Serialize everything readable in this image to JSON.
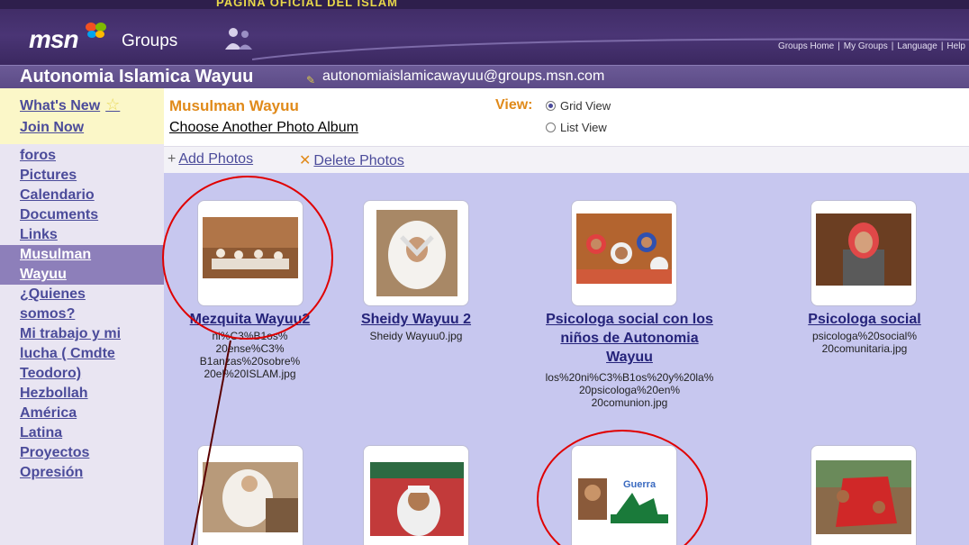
{
  "header": {
    "banner": "PAGINA OFICIAL DEL ISLAM",
    "logo": "msn",
    "product": "Groups",
    "links": [
      "Groups Home",
      "My Groups",
      "Language",
      "Help"
    ]
  },
  "group": {
    "name": "Autonomia Islamica Wayuu",
    "email": "autonomiaislamicawayuu@groups.msn.com"
  },
  "sidebar": {
    "top": [
      {
        "label": "What's New"
      },
      {
        "label": "Join Now"
      }
    ],
    "nav": [
      {
        "label": "foros"
      },
      {
        "label": "Pictures"
      },
      {
        "label": "Calendario"
      },
      {
        "label": "Documents"
      },
      {
        "label": "Links"
      },
      {
        "label": "Musulman"
      },
      {
        "label": "Wayuu"
      },
      {
        "label": "¿Quienes"
      },
      {
        "label": "somos?"
      },
      {
        "label": "Mi trabajo y mi"
      },
      {
        "label": "lucha ( Cmdte"
      },
      {
        "label": "Teodoro)"
      },
      {
        "label": "Hezbollah"
      },
      {
        "label": "América"
      },
      {
        "label": "Latina"
      },
      {
        "label": "Proyectos"
      },
      {
        "label": "Opresión"
      }
    ]
  },
  "album": {
    "title": "Musulman Wayuu",
    "choose": "Choose Another Photo Album",
    "view_label": "View:",
    "view_options": [
      "Grid View",
      "List View"
    ],
    "selected_view": "Grid View"
  },
  "toolbar": {
    "add": "Add Photos",
    "delete": "Delete Photos"
  },
  "photos": [
    {
      "title": [
        "Mezquita Wayuu2"
      ],
      "file": [
        "ni%C3%B1os%",
        "20ense%C3%",
        "B1anzas%20sobre%",
        "20el%20ISLAM.jpg"
      ]
    },
    {
      "title": [
        "Sheidy Wayuu 2"
      ],
      "file": [
        "Sheidy Wayuu0.jpg"
      ]
    },
    {
      "title": [
        "Psicologa social con los",
        "niños de Autonomia",
        "Wayuu"
      ],
      "file": [
        "los%20ni%C3%B1os%20y%20la%",
        "20psicologa%20en%",
        "20comunion.jpg"
      ]
    },
    {
      "title": [
        "Psicologa social"
      ],
      "file": [
        "psicologa%20social%",
        "20comunitaria.jpg"
      ]
    },
    {
      "title": [],
      "file": []
    },
    {
      "title": [],
      "file": []
    },
    {
      "title": [],
      "file": [],
      "thumb_text": "Guerra"
    },
    {
      "title": [],
      "file": []
    }
  ],
  "colors": {
    "header_bg": "#3e2a63",
    "group_bar": "#5c4b87",
    "grid_bg": "#c7c7ef",
    "link": "#4b4b9a",
    "accent_orange": "#e08a1a",
    "annotation_red": "#e00000"
  }
}
